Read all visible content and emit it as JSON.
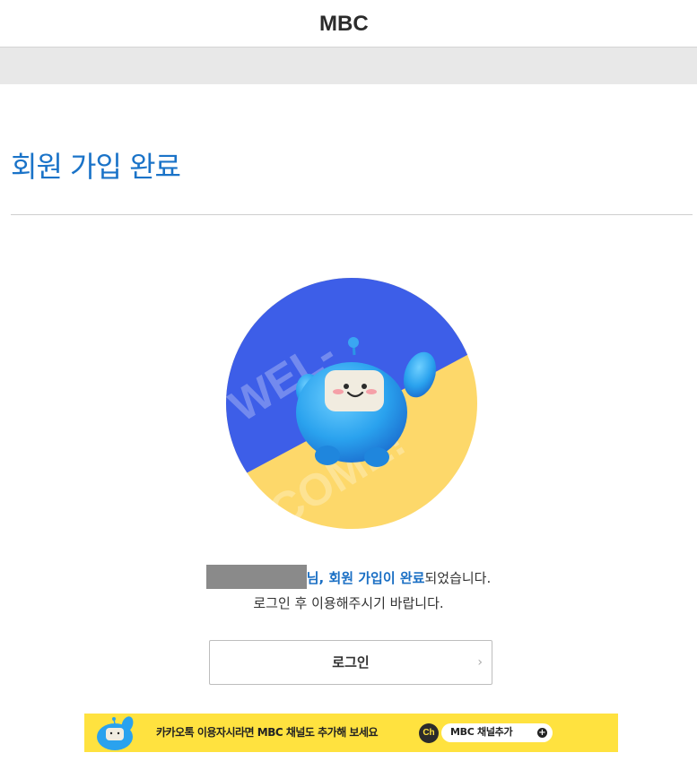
{
  "header": {
    "logo": "MBC"
  },
  "page_title": "회원 가입 완료",
  "hero": {
    "text_top": "WEL-",
    "text_bottom": "COME!"
  },
  "message": {
    "suffix_highlight": "님, 회원 가입이 완료",
    "suffix_plain": "되었습니다.",
    "line2": "로그인 후 이용해주시기 바랍니다."
  },
  "login_button": {
    "label": "로그인",
    "chevron": "›"
  },
  "kakao_banner": {
    "text": "카카오톡 이용자시라면 MBC 채널도 추가해 보세요",
    "channel_icon": "Ch",
    "channel_button": "MBC 채널추가",
    "plus": "+"
  },
  "colors": {
    "accent": "#1a73c8",
    "hero_blue": "#3d5ee8",
    "hero_yellow": "#fdd86a",
    "kakao_yellow": "#ffe23f"
  },
  "icons": [
    "mbc-logo",
    "mascot-icon",
    "chevron-right-icon",
    "kakao-channel-icon",
    "plus-circle-icon"
  ]
}
